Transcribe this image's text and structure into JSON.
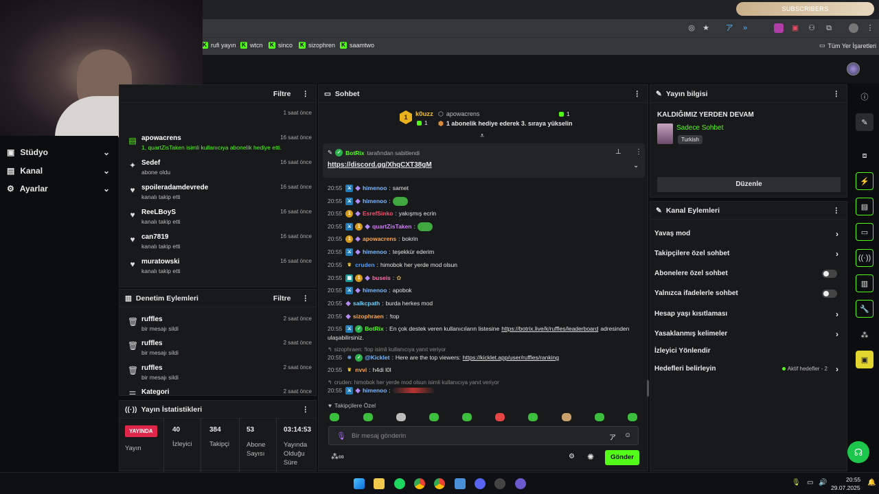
{
  "browser": {
    "subscribers_label": "SUBSCRIBERS",
    "bookmarks": [
      "rufi yayın",
      "wtcn",
      "sinco",
      "sizophren",
      "saamtwo"
    ],
    "bookmarks_folder": "Tüm Yer İşaretleri"
  },
  "sidebar": {
    "items": [
      {
        "label": "Stüdyo"
      },
      {
        "label": "Kanal"
      },
      {
        "label": "Ayarlar"
      }
    ]
  },
  "activity": {
    "filter_label": "Filtre",
    "events": [
      {
        "name": "",
        "sub": "",
        "time": "1 saat önce"
      },
      {
        "name": "apowacrens",
        "sub": "1, quartZisTaken isimli kullanıcıya abonelik hediye etti.",
        "time": "16 saat önce"
      },
      {
        "name": "Sedef",
        "sub": "abone oldu",
        "time": "16 saat önce"
      },
      {
        "name": "spoileradamdevrede",
        "sub": "kanalı takip etti",
        "time": "16 saat önce"
      },
      {
        "name": "ReeLBoyS",
        "sub": "kanalı takip etti",
        "time": "16 saat önce"
      },
      {
        "name": "can7819",
        "sub": "kanalı takip etti",
        "time": "16 saat önce"
      },
      {
        "name": "muratowski",
        "sub": "kanalı takip etti",
        "time": "16 saat önce"
      }
    ]
  },
  "moderation": {
    "title": "Denetim Eylemleri",
    "filter_label": "Filtre",
    "events": [
      {
        "name": "ruffles",
        "sub": "bir mesajı sildi",
        "time": "2 saat önce"
      },
      {
        "name": "ruffles",
        "sub": "bir mesajı sildi",
        "time": "2 saat önce"
      },
      {
        "name": "ruffles",
        "sub": "bir mesajı sildi",
        "time": "2 saat önce"
      },
      {
        "name": "Kategori",
        "sub": "",
        "time": "2 saat önce"
      }
    ]
  },
  "stats": {
    "title": "Yayın İstatistikleri",
    "live_badge": "YAYINDA",
    "live_label": "Yayın",
    "viewers": {
      "value": "40",
      "label": "İzleyici"
    },
    "followers": {
      "value": "384",
      "label": "Takipçi"
    },
    "subs": {
      "value": "53",
      "label": "Abone Sayısı"
    },
    "uptime": {
      "value": "03:14:53",
      "label": "Yayında Olduğu Süre"
    }
  },
  "chat": {
    "title": "Sohbet",
    "leader": {
      "rank": "1",
      "name": "k0uzz",
      "count": "1",
      "gifter": "apowacrens",
      "gifter_count": "1",
      "event_text": "1 abonelik hediye ederek 3. sıraya yükselin"
    },
    "pinned": {
      "user": "BotRix",
      "by": "tarafından sabitlendi",
      "link": "https://discord.gg/XhqCXT38gM"
    },
    "messages": [
      {
        "time": "20:55",
        "user": "himenoo",
        "color": "#7db8ff",
        "text": "samet"
      },
      {
        "time": "20:55",
        "user": "himenoo",
        "color": "#7db8ff",
        "text": ""
      },
      {
        "time": "20:55",
        "user": "EsrefSinko",
        "color": "#ff4f6b",
        "text": "yakışmış ecrin"
      },
      {
        "time": "20:55",
        "user": "quartZisTaken",
        "color": "#d77cff",
        "text": ""
      },
      {
        "time": "20:55",
        "user": "apowacrens",
        "color": "#ffa84f",
        "text": "bokrin"
      },
      {
        "time": "20:55",
        "user": "himenoo",
        "color": "#7db8ff",
        "text": "teşekkür ederim"
      },
      {
        "time": "20:55",
        "user": "cruden",
        "color": "#4fa0ff",
        "text": "himobok her yerde mod olsun"
      },
      {
        "time": "20:55",
        "user": "buseis",
        "color": "#ff6fb1",
        "text": ""
      },
      {
        "time": "20:55",
        "user": "himenoo",
        "color": "#7db8ff",
        "text": "apobok"
      },
      {
        "time": "20:55",
        "user": "salkcpath",
        "color": "#6fd3ff",
        "text": "burda herkes mod"
      },
      {
        "time": "20:55",
        "user": "sizophraen",
        "color": "#ffa84f",
        "text": "!top"
      },
      {
        "time": "20:55",
        "user": "BotRix",
        "color": "#53fc18",
        "text": "En çok destek veren kullanıcıların listesine",
        "link": "https://botrix.live/k/ruffles/leaderboard",
        "tail": "adresinden",
        "line2": "ulaşabilirsiniz."
      },
      {
        "reply": "sizophraen: !top isimli kullanıcıya yanıt veriyor"
      },
      {
        "time": "20:55",
        "user": "@Kicklet",
        "color": "#7db8ff",
        "text": "Here are the top viewers:",
        "link": "https://kicklet.app/user/ruffles/ranking"
      },
      {
        "time": "20:55",
        "user": "nvvi",
        "color": "#ffa84f",
        "text": "h4di l0l"
      },
      {
        "reply": "cruden: himobok her yerde mod olsun isimli kullanıcıya yanıt veriyor"
      },
      {
        "time": "20:55",
        "user": "himenoo",
        "color": "#7db8ff",
        "text": ""
      }
    ],
    "follower_only_label": "Takipçilere Özel",
    "input_placeholder": "Bir mesaj gönderin",
    "send_label": "Gönder"
  },
  "stream_info": {
    "title": "Yayın bilgisi",
    "stream_title": "KALDIĞIMIZ YERDEN DEVAM",
    "category": "Sadece Sohbet",
    "language": "Turkish",
    "edit_label": "Düzenle"
  },
  "channel_actions": {
    "title": "Kanal Eylemleri",
    "items": [
      {
        "label": "Yavaş mod",
        "kind": "chevron"
      },
      {
        "label": "Takipçilere özel sohbet",
        "kind": "chevron"
      },
      {
        "label": "Abonelere özel sohbet",
        "kind": "toggle"
      },
      {
        "label": "Yalnızca ifadelerle sohbet",
        "kind": "toggle"
      },
      {
        "label": "Hesap yaşı kısıtlaması",
        "kind": "chevron"
      },
      {
        "label": "Yasaklanmış kelimeler",
        "kind": "chevron"
      },
      {
        "label": "İzleyici Yönlendir",
        "kind": "none"
      },
      {
        "label": "Hedefleri belirleyin",
        "kind": "chevron",
        "extra": "Aktif hedefler - 2"
      }
    ]
  },
  "taskbar": {
    "time": "20:55",
    "date": "29.07.2025"
  },
  "colors": {
    "accent": "#53fc18",
    "panel": "#18191b",
    "live": "#e0264a"
  }
}
